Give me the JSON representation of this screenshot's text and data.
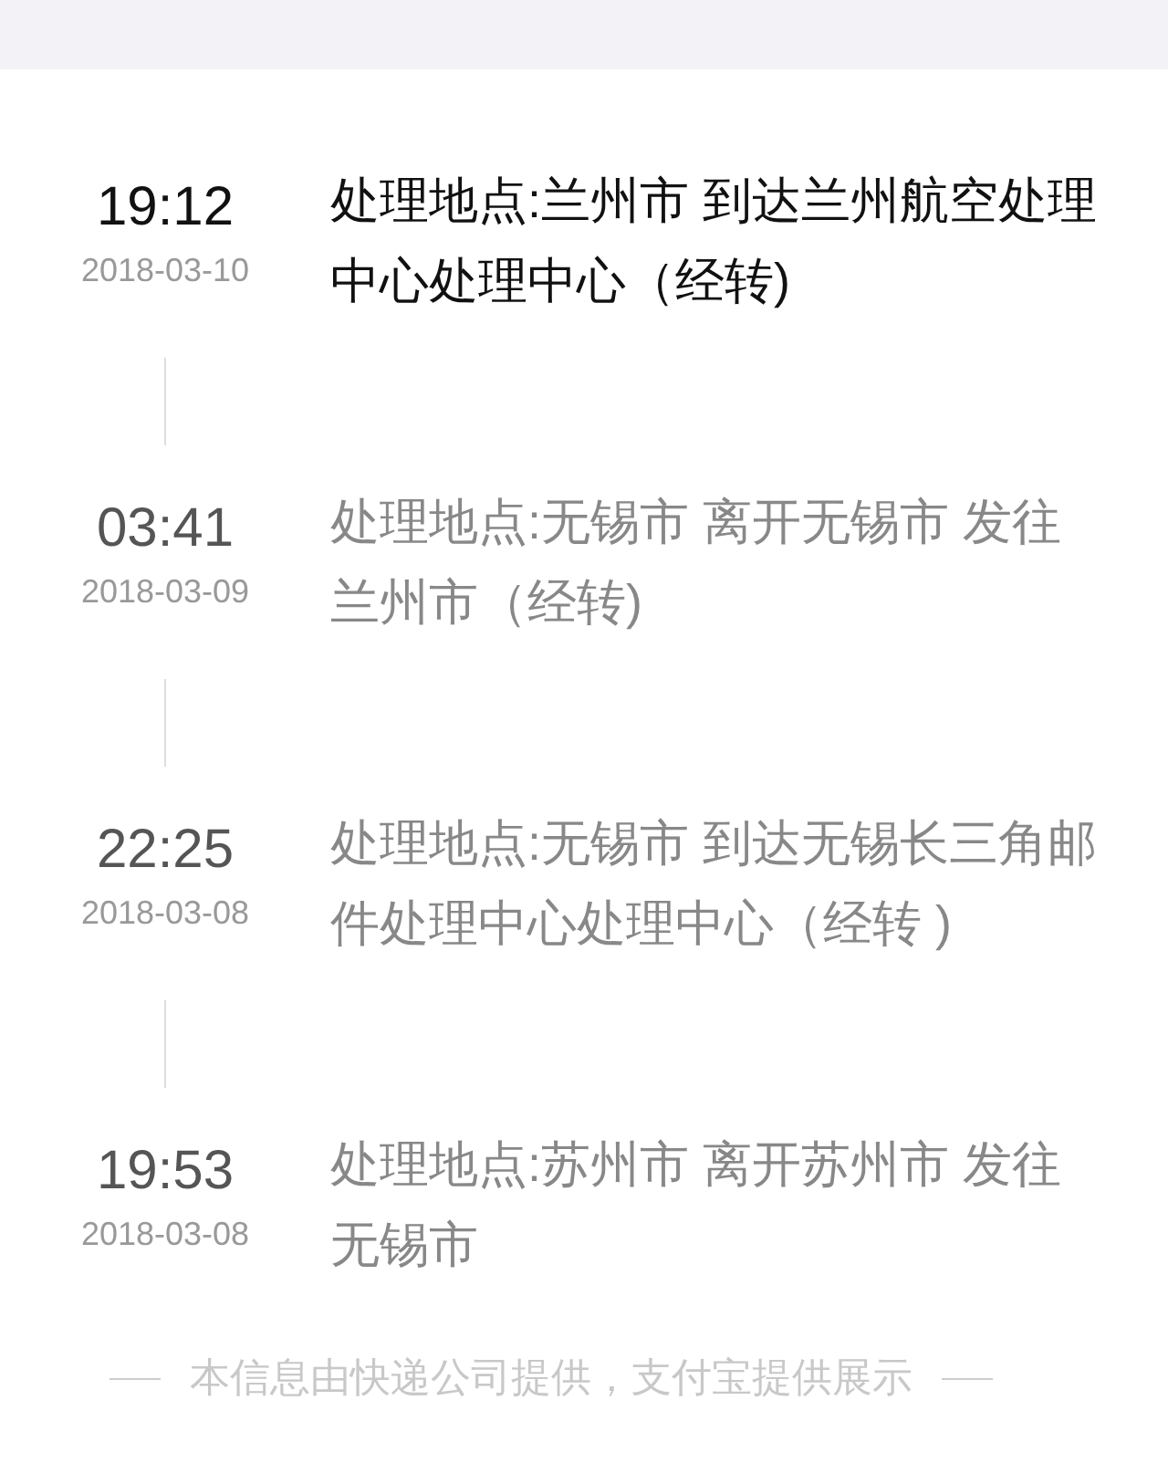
{
  "events": [
    {
      "time": "19:12",
      "date": "2018-03-10",
      "text": "处理地点:兰州市 到达兰州航空处理中心处理中心（经转)",
      "current": true
    },
    {
      "time": "03:41",
      "date": "2018-03-09",
      "text": "处理地点:无锡市 离开无锡市 发往兰州市（经转)",
      "current": false
    },
    {
      "time": "22:25",
      "date": "2018-03-08",
      "text": "处理地点:无锡市 到达无锡长三角邮件处理中心处理中心（经转 )",
      "current": false
    },
    {
      "time": "19:53",
      "date": "2018-03-08",
      "text": "处理地点:苏州市 离开苏州市 发往无锡市",
      "current": false
    }
  ],
  "footer": "本信息由快递公司提供，支付宝提供展示"
}
